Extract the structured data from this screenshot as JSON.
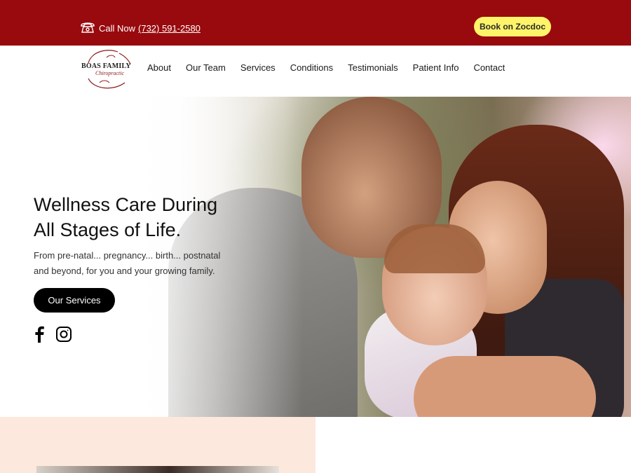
{
  "topbar": {
    "call_label": "Call Now",
    "phone": "(732) 591-2580",
    "book_button": "Book on Zocdoc"
  },
  "logo": {
    "line1": "BOAS FAMILY",
    "line2": "Chiropractic"
  },
  "nav": {
    "items": [
      "About",
      "Our Team",
      "Services",
      "Conditions",
      "Testimonials",
      "Patient Info",
      "Contact"
    ]
  },
  "hero": {
    "title_line1": "Wellness Care During",
    "title_line2": "All Stages of Life.",
    "subtitle": "From  pre-natal... pregnancy... birth... postnatal and beyond, for you and your growing family.",
    "cta": "Our Services",
    "social_icons": [
      "facebook-icon",
      "instagram-icon"
    ]
  },
  "colors": {
    "topbar": "#980a0e",
    "book_button": "#fdf46a",
    "cta": "#000000",
    "section_bg": "#fde8de"
  }
}
